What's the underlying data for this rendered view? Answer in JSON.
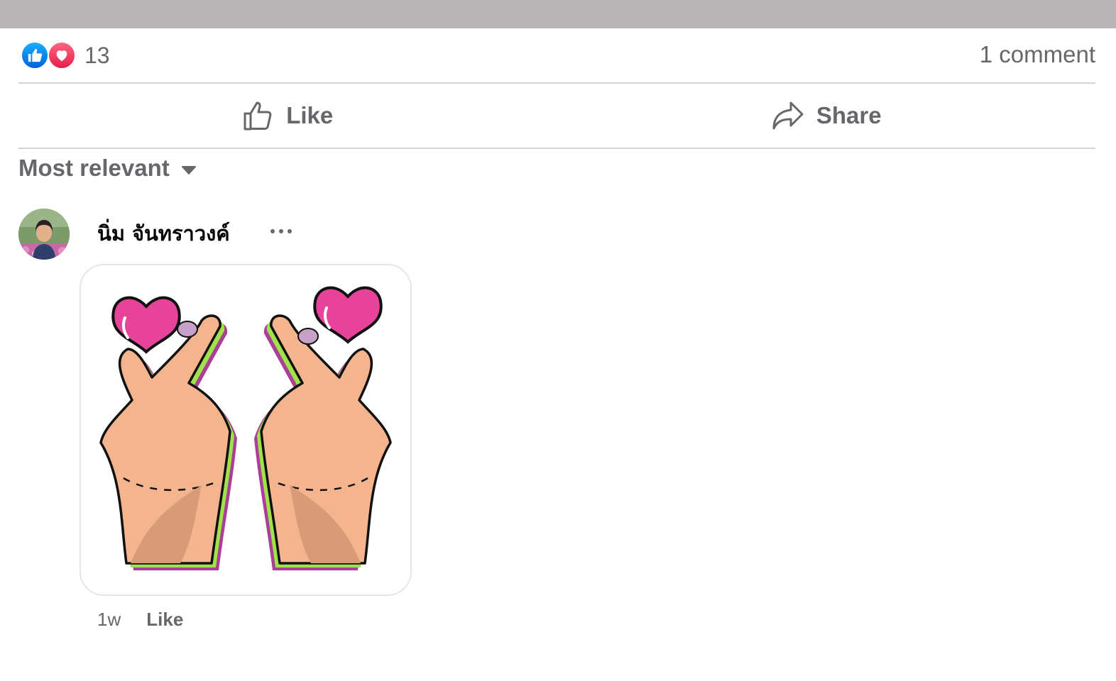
{
  "reactions": {
    "icons": [
      "like-reaction-icon",
      "love-reaction-icon"
    ],
    "count": "13",
    "like_color": "#1877f2",
    "love_color": "#f02849"
  },
  "comment_count": "1 comment",
  "actions": {
    "like_label": "Like",
    "share_label": "Share"
  },
  "sort": {
    "label": "Most relevant"
  },
  "comment": {
    "author": "นิ่ม จันทราวงค์",
    "sticker": "finger-heart-hands-sticker",
    "timestamp": "1w",
    "like_label": "Like"
  },
  "colors": {
    "topbar": "#b9b4b5",
    "text_secondary": "#65676b",
    "text_primary": "#050505",
    "divider": "#d3d3d3",
    "heart_pink": "#e8439a"
  }
}
